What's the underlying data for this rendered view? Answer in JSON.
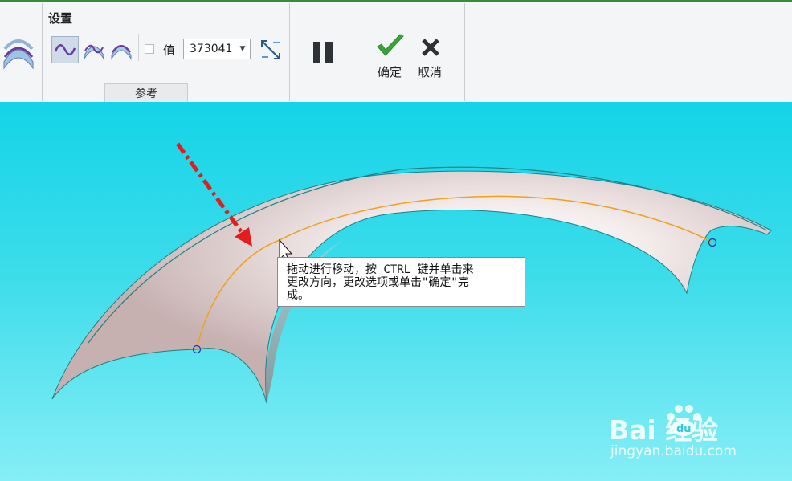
{
  "ribbon": {
    "group_title": "设置",
    "value_label": "值",
    "value_combo": "373041",
    "reference_tab": "参考",
    "ok_label": "确定",
    "cancel_label": "取消"
  },
  "viewport": {
    "tooltip": "拖动进行移动，按 CTRL 键并单击来\n更改方向，更改选项或单击\"确定\"完\n成。"
  },
  "watermark": {
    "brand": "Bai  经验",
    "url": "jingyan.baidu.com"
  },
  "colors": {
    "background": "#17d6ea",
    "ok_check": "#3aa43a",
    "arrow": "#e21d1d",
    "curve": "#f0a020",
    "edge": "#1f7f86"
  }
}
